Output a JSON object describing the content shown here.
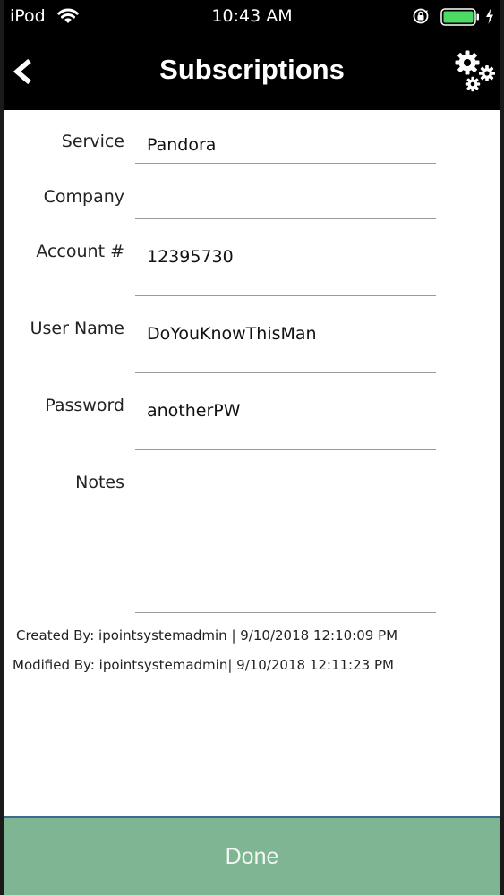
{
  "status_bar": {
    "carrier": "iPod",
    "time": "10:43 AM"
  },
  "nav": {
    "title": "Subscriptions"
  },
  "form": {
    "service_label": "Service",
    "service_value": "Pandora",
    "company_label": "Company",
    "company_value": "",
    "account_label": "Account #",
    "account_value": "12395730",
    "username_label": "User Name",
    "username_value": "DoYouKnowThisMan",
    "password_label": "Password",
    "password_value": "anotherPW",
    "notes_label": "Notes",
    "notes_value": ""
  },
  "meta": {
    "created": "Created By: ipointsystemadmin | 9/10/2018 12:10:09 PM",
    "modified": "Modified By: ipointsystemadmin| 9/10/2018 12:11:23 PM"
  },
  "footer": {
    "done_label": "Done"
  },
  "colors": {
    "nav_bg": "#000000",
    "footer_bg": "#7fb592",
    "battery_fill": "#4cd964"
  },
  "icons": [
    "wifi-icon",
    "orientation-lock-icon",
    "battery-icon",
    "charging-bolt-icon",
    "back-chevron-icon",
    "settings-gears-icon"
  ]
}
